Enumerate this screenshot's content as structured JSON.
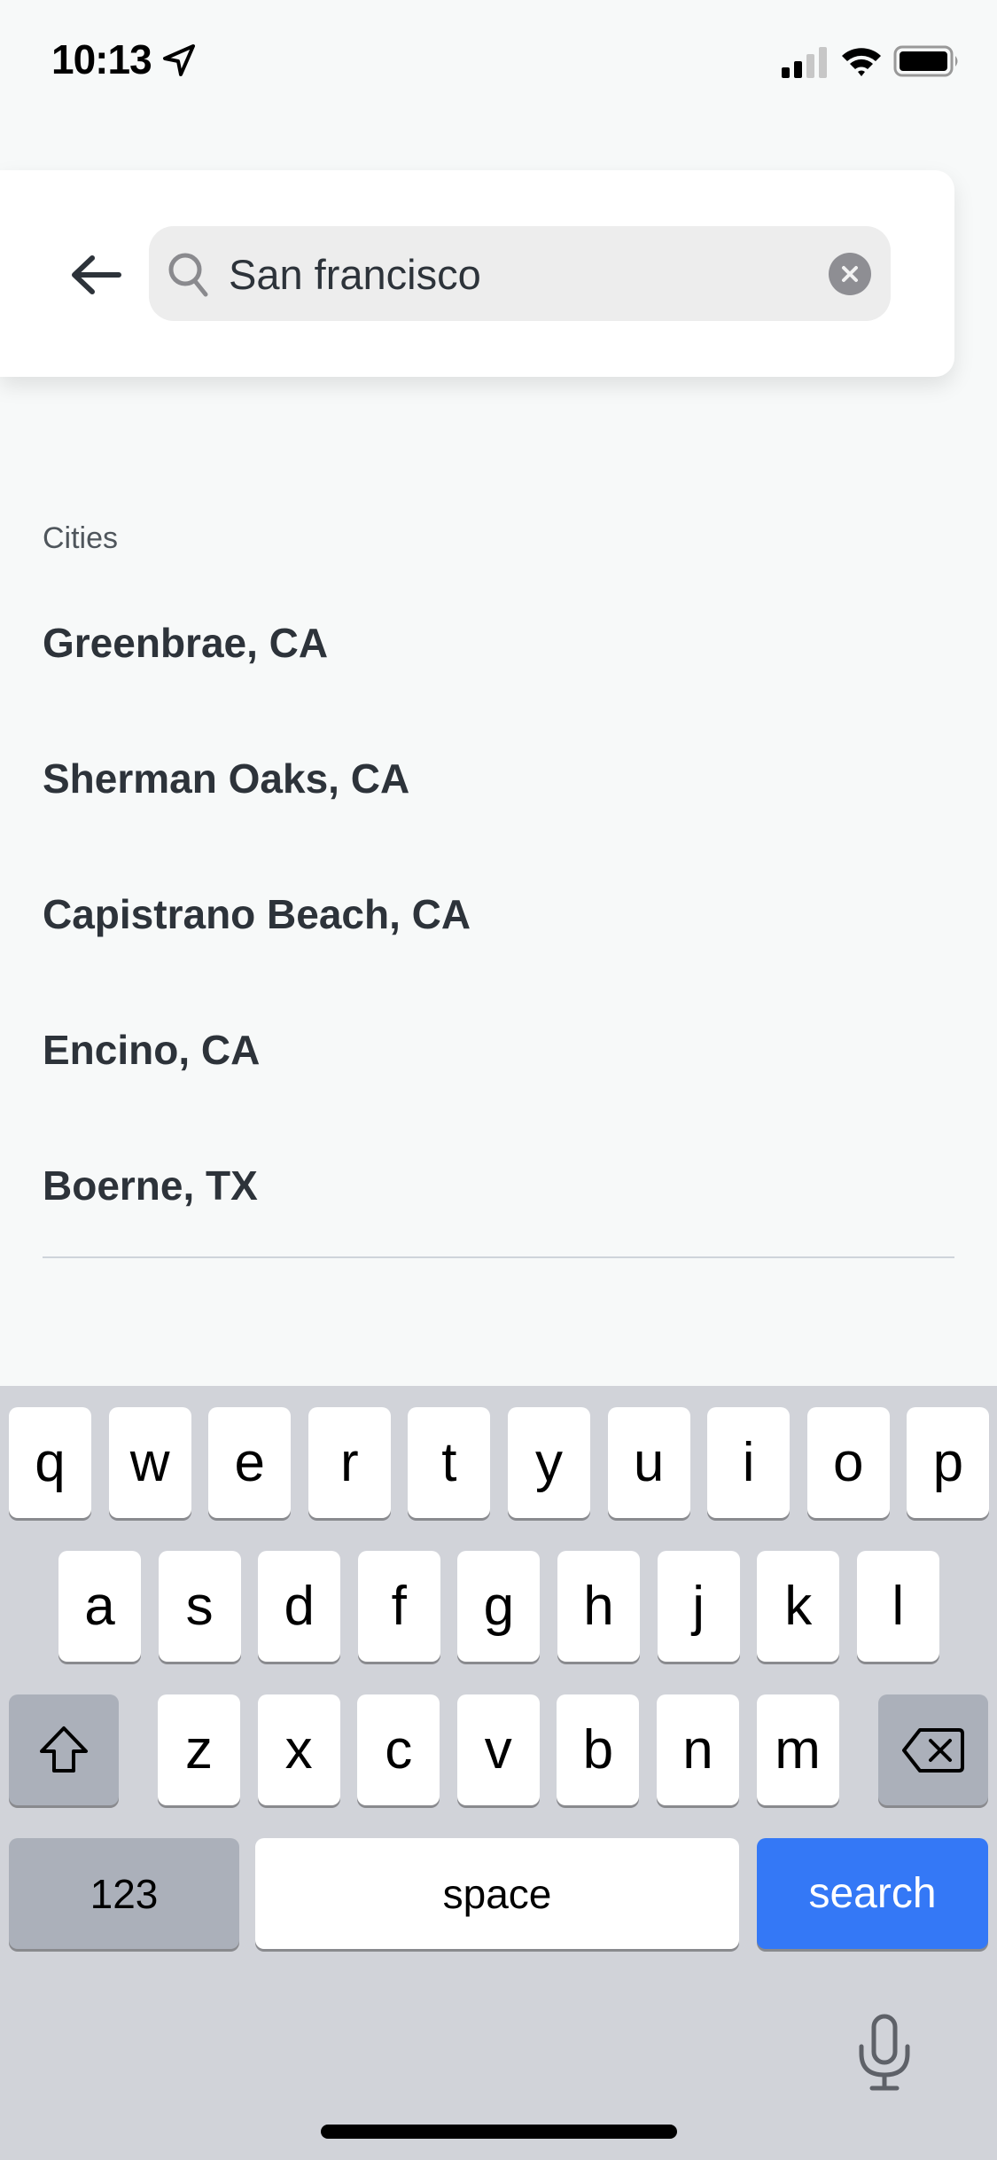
{
  "status_bar": {
    "time": "10:13",
    "icons": [
      "location-arrow-icon",
      "cellular-signal-icon",
      "wifi-icon",
      "battery-icon"
    ]
  },
  "header": {
    "back_icon": "arrow-left-icon",
    "search": {
      "icon": "search-icon",
      "value": "San francisco",
      "clear_icon": "clear-x-icon"
    }
  },
  "results": {
    "section_label": "Cities",
    "items": [
      {
        "label": "Greenbrae, CA"
      },
      {
        "label": "Sherman Oaks, CA"
      },
      {
        "label": "Capistrano Beach, CA"
      },
      {
        "label": "Encino, CA"
      },
      {
        "label": "Boerne, TX"
      }
    ]
  },
  "keyboard": {
    "row1": [
      "q",
      "w",
      "e",
      "r",
      "t",
      "y",
      "u",
      "i",
      "o",
      "p"
    ],
    "row2": [
      "a",
      "s",
      "d",
      "f",
      "g",
      "h",
      "j",
      "k",
      "l"
    ],
    "row3": [
      "z",
      "x",
      "c",
      "v",
      "b",
      "n",
      "m"
    ],
    "shift_icon": "shift-icon",
    "backspace_icon": "backspace-icon",
    "numbers_label": "123",
    "space_label": "space",
    "search_label": "search",
    "mic_icon": "microphone-icon",
    "accent_color": "#3478F6"
  }
}
